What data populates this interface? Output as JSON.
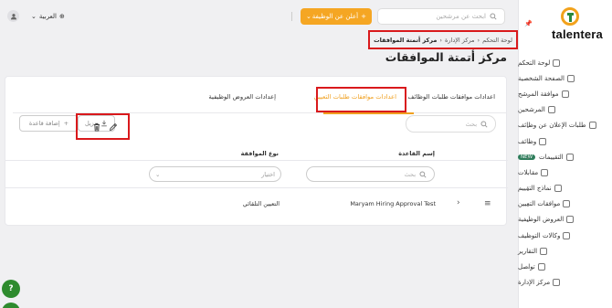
{
  "app": {
    "logo_text": "talentera"
  },
  "topbar": {
    "language": "العربية",
    "post_job_label": "أعلن عن الوظيفة",
    "search_placeholder": "ابحث عن مرشحين"
  },
  "breadcrumb": {
    "items": [
      "لوحة التحكم",
      "مركز الإدارة"
    ],
    "current": "مركز أتمتة الموافقات"
  },
  "page_title": "مركز أتمتة الموافقات",
  "sidebar": {
    "items": [
      {
        "label": "لوحة التحكم",
        "chevron": false
      },
      {
        "label": "الصفحة الشخصية",
        "chevron": true
      },
      {
        "label": "موافقة المرشح",
        "chevron": true
      },
      {
        "label": "المرشحين",
        "chevron": false
      },
      {
        "label": "طلبات الإعلان عن وظائف",
        "chevron": true
      },
      {
        "label": "وظائف",
        "chevron": true
      },
      {
        "label": "التقييمات",
        "chevron": true,
        "badge": "NEW"
      },
      {
        "label": "مقابلات",
        "chevron": true
      },
      {
        "label": "نماذج التقييم",
        "chevron": true
      },
      {
        "label": "موافقات التعيين",
        "chevron": true
      },
      {
        "label": "العروض الوظيفية",
        "chevron": true
      },
      {
        "label": "وكالات التوظيف",
        "chevron": true
      },
      {
        "label": "التقارير",
        "chevron": true
      },
      {
        "label": "تواصل",
        "chevron": true
      },
      {
        "label": "مركز الإدارة",
        "chevron": false
      }
    ]
  },
  "tabs": [
    {
      "label": "اعدادات موافقات طلبات الوظائف",
      "active": false
    },
    {
      "label": "اعدادات موافقات طلبات التعيين",
      "active": true
    },
    {
      "label": "إعدادات العروض الوظيفية",
      "active": false
    }
  ],
  "toolbar": {
    "add_rule_label": "إضافة قاعدة",
    "download_label": "تنزيل",
    "search_placeholder": "بحث"
  },
  "table": {
    "columns": [
      "إسم القاعدة",
      "نوع الموافقة"
    ],
    "filters": {
      "rule_name_placeholder": "بحث",
      "approval_type_placeholder": "اختيار"
    },
    "rows": [
      {
        "rule_name": "Maryam Hiring Approval Test",
        "approval_type": "التعيين التلقائي"
      }
    ]
  },
  "help": {
    "label": "?"
  }
}
